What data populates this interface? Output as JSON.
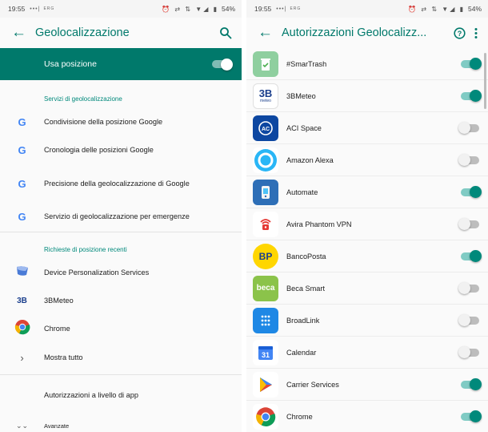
{
  "left": {
    "status": {
      "time": "19:55",
      "dots": "•••|",
      "dots_sub": "ERG",
      "icons": "⏰ ⇄ ⇅ ▼◢ ▮",
      "battery": "54%"
    },
    "appbar": {
      "title": "Geolocalizzazione"
    },
    "use_location": {
      "label": "Usa posizione",
      "on": true
    },
    "section_services": "Servizi di geolocalizzazione",
    "services": [
      {
        "label": "Condivisione della posizione Google",
        "icon": "google-g-icon"
      },
      {
        "label": "Cronologia delle posizioni Google",
        "icon": "google-g-icon"
      },
      {
        "label": "Precisione della geolocalizzazione di Google",
        "icon": "google-g-icon"
      },
      {
        "label": "Servizio di geolocalizzazione per emergenze",
        "icon": "google-g-icon"
      }
    ],
    "section_recent": "Richieste di posizione recenti",
    "recent": [
      {
        "label": "Device Personalization Services",
        "icon": "device-personalization-icon"
      },
      {
        "label": "3BMeteo",
        "icon": "3bmeteo-icon"
      },
      {
        "label": "Chrome",
        "icon": "chrome-icon"
      }
    ],
    "show_all": "Mostra tutto",
    "app_permissions": "Autorizzazioni a livello di app",
    "advanced": "Avanzate"
  },
  "right": {
    "status": {
      "time": "19:55",
      "dots": "•••|",
      "dots_sub": "ERG",
      "icons": "⏰ ⇄ ⇅ ▼◢ ▮",
      "battery": "54%"
    },
    "appbar": {
      "title": "Autorizzazioni Geolocalizz..."
    },
    "apps": [
      {
        "name": "#SmarTrash",
        "on": true,
        "color": "#9ccc9c",
        "glyph": "🗑"
      },
      {
        "name": "3BMeteo",
        "on": true,
        "color": "#ffffff",
        "glyph": "3B"
      },
      {
        "name": "ACI Space",
        "on": false,
        "color": "#1565c0",
        "glyph": "AC"
      },
      {
        "name": "Amazon Alexa",
        "on": false,
        "color": "#29b6f6",
        "glyph": "◯"
      },
      {
        "name": "Automate",
        "on": true,
        "color": "#2e6fb7",
        "glyph": "⚙"
      },
      {
        "name": "Avira Phantom VPN",
        "on": false,
        "color": "#ffffff",
        "glyph": "🔒"
      },
      {
        "name": "BancoPosta",
        "on": true,
        "color": "#ffd600",
        "glyph": "BP"
      },
      {
        "name": "Beca Smart",
        "on": false,
        "color": "#8bc34a",
        "glyph": "beca"
      },
      {
        "name": "BroadLink",
        "on": false,
        "color": "#1e88e5",
        "glyph": "⣿"
      },
      {
        "name": "Calendar",
        "on": false,
        "color": "#ffffff",
        "glyph": "31"
      },
      {
        "name": "Carrier Services",
        "on": true,
        "color": "#ffffff",
        "glyph": "▶"
      },
      {
        "name": "Chrome",
        "on": true,
        "color": "#ffffff",
        "glyph": "◉"
      }
    ]
  },
  "colors": {
    "accent": "#00796b",
    "switch_on": "#00897b",
    "switch_off": "#bdbdbd"
  }
}
